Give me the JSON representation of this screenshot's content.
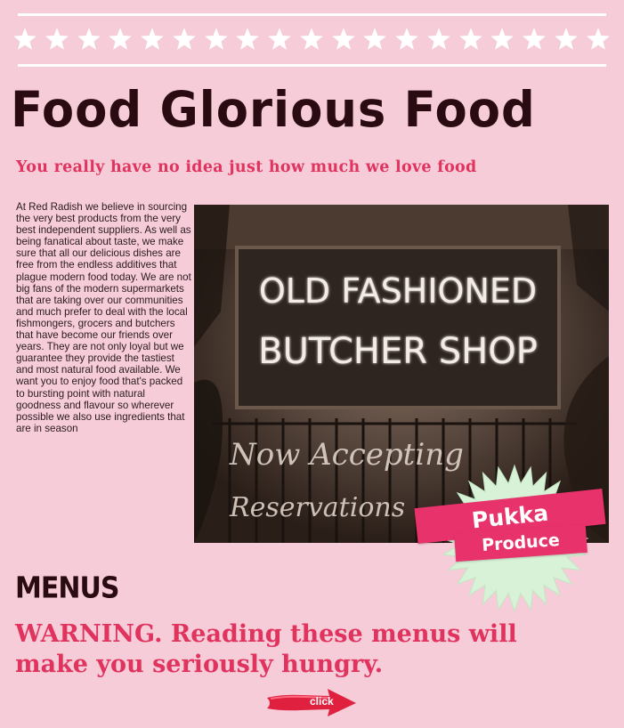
{
  "header": {
    "title": "Food Glorious Food",
    "subtitle": "You really have no idea just how much we love food"
  },
  "intro": {
    "body": "At Red Radish we believe in sourcing the very best products from the very best independent suppliers. As well as being fanatical about taste, we make sure that all our delicious dishes are free from the endless additives that plague modern food today. We are not big fans of the modern supermarkets that are taking over our communities and much prefer to deal with the local fishmongers, grocers and butchers that have become our friends over years. They are not only loyal but we guarantee they provide the tastiest and most natural food available. We want you to enjoy food that's packed to bursting point with natural goodness and flavour so wherever possible we also use ingredients that are in season"
  },
  "photo": {
    "sign_line1": "OLD FASHIONED",
    "sign_line2": "BUTCHER SHOP",
    "script_line1": "Now Accepting",
    "script_line2": "Reservations"
  },
  "badge": {
    "top_label": "Pukka",
    "bottom_label": "Produce"
  },
  "menus": {
    "heading": "MENUS",
    "warning": "WARNING. Reading these menus will make you seriously hungry.",
    "click_label": "click"
  },
  "colors": {
    "background": "#f6ccd9",
    "accent": "#e0335e",
    "title": "#2b0b12"
  }
}
